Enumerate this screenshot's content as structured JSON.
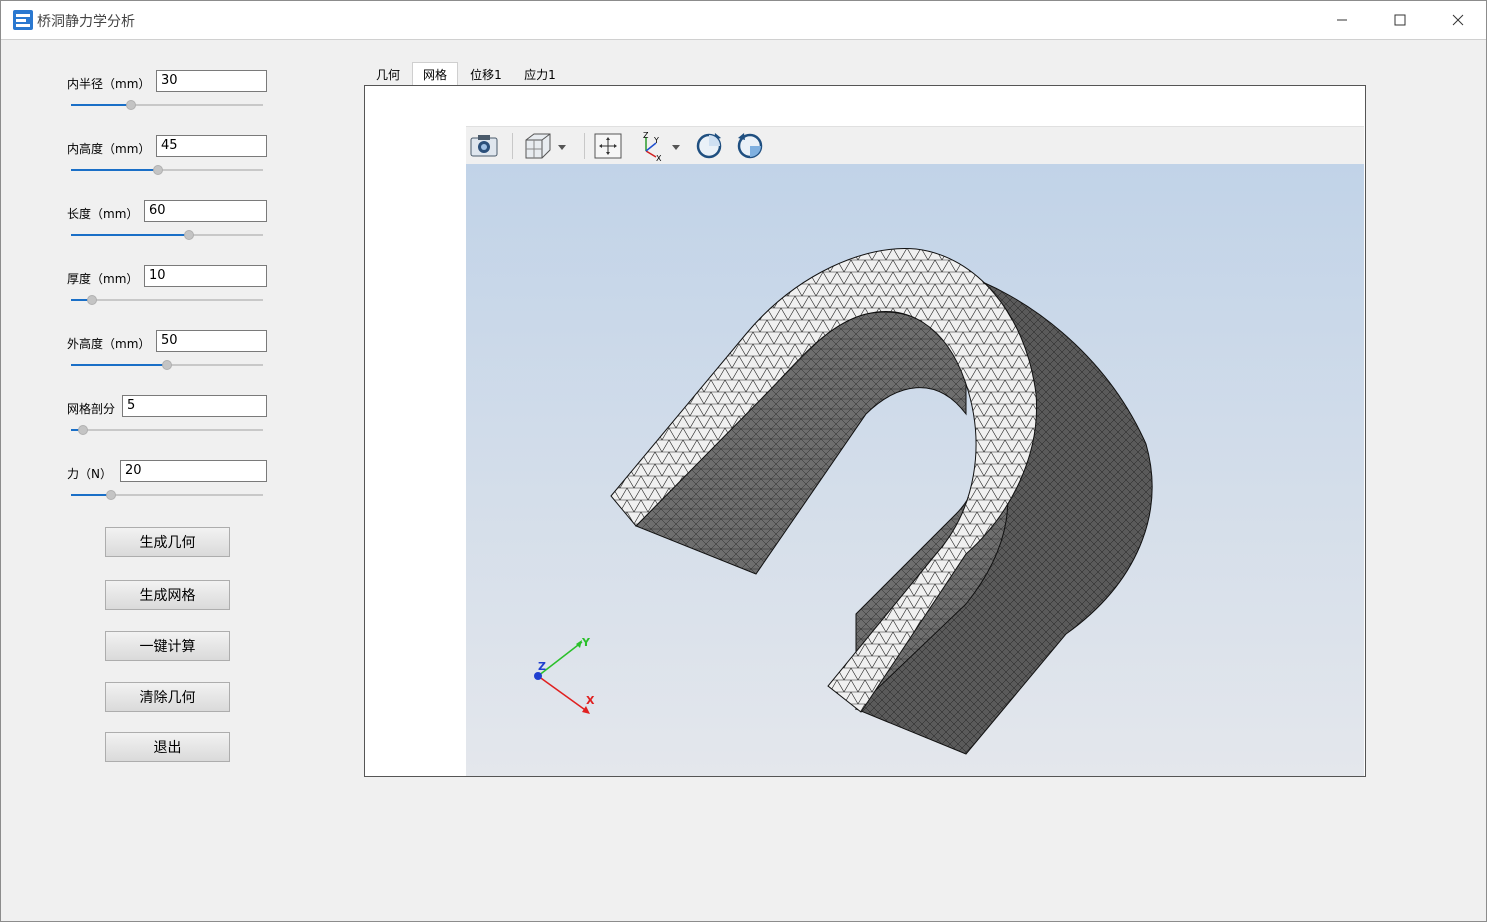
{
  "window": {
    "title": "桥洞静力学分析"
  },
  "params": [
    {
      "label": "内半径（mm）",
      "value": "30",
      "fraction": 0.3
    },
    {
      "label": "内高度（mm）",
      "value": "45",
      "fraction": 0.45
    },
    {
      "label": "长度（mm）",
      "value": "60",
      "fraction": 0.62
    },
    {
      "label": "厚度（mm）",
      "value": "10",
      "fraction": 0.09
    },
    {
      "label": "外高度（mm）",
      "value": "50",
      "fraction": 0.5
    },
    {
      "label": "网格剖分",
      "value": "5",
      "fraction": 0.04
    },
    {
      "label": "力（N）",
      "value": "20",
      "fraction": 0.19
    }
  ],
  "buttons": {
    "gen_geometry": "生成几何",
    "gen_mesh": "生成网格",
    "compute": "一键计算",
    "clear": "清除几何",
    "exit": "退出"
  },
  "tabs": [
    "几何",
    "网格",
    "位移1",
    "应力1"
  ],
  "active_tab": "网格",
  "viewer": {
    "toolbar_icons": [
      "camera-icon",
      "view-cube-icon",
      "fit-all-icon",
      "axes-icon",
      "rotate-cw-icon",
      "rotate-ccw-icon"
    ],
    "triad": {
      "x": "X",
      "y": "Y",
      "z": "Z"
    }
  },
  "colors": {
    "slider_fill": "#1a6fc7",
    "mesh_face": "#6e6e6e",
    "mesh_top": "#f2f2f2"
  }
}
